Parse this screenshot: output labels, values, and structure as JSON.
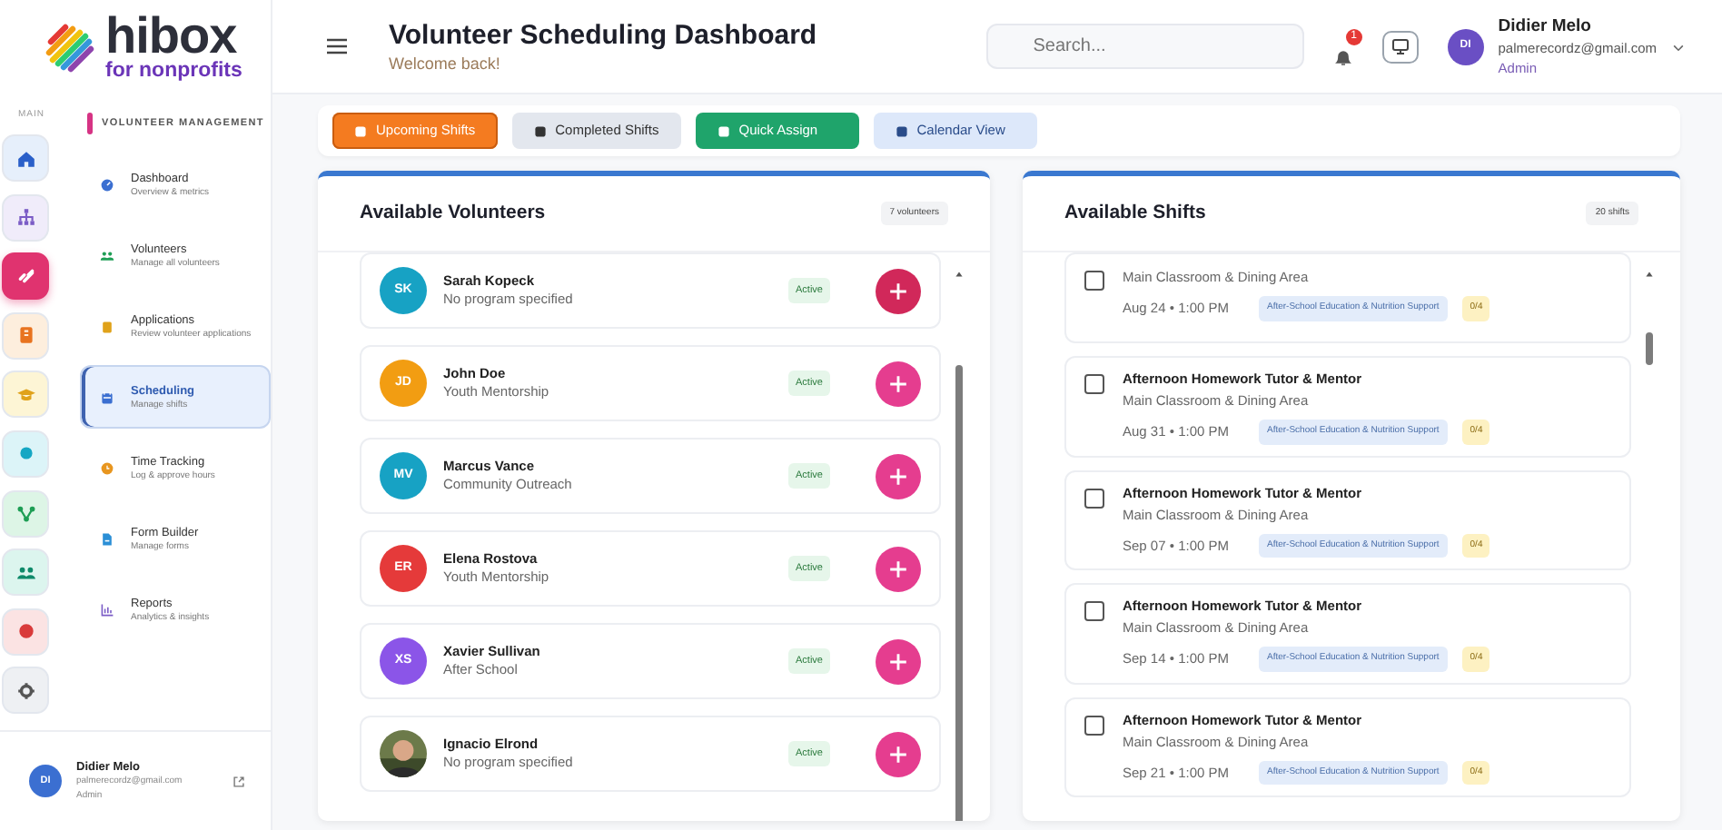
{
  "logo": {
    "name": "hibox",
    "tagline": "for nonprofits"
  },
  "header": {
    "title": "Volunteer Scheduling Dashboard",
    "subtitle": "Welcome back!",
    "search": {
      "placeholder": "Search..."
    },
    "notification_count": "1",
    "user": {
      "initials": "DI",
      "name": "Didier Melo",
      "email": "palmerecordz@gmail.com",
      "role": "Admin"
    }
  },
  "sidebar": {
    "rail_label": "MAIN",
    "rail": [
      {
        "selected": false
      },
      {
        "selected": false
      },
      {
        "selected": true
      },
      {
        "selected": false
      },
      {
        "selected": false
      },
      {
        "selected": false
      },
      {
        "selected": false
      },
      {
        "selected": false
      },
      {
        "selected": false
      },
      {
        "selected": false
      }
    ],
    "section": "VOLUNTEER MANAGEMENT",
    "items": [
      {
        "title": "Dashboard",
        "subtitle": "Overview & metrics",
        "selected": false
      },
      {
        "title": "Volunteers",
        "subtitle": "Manage all volunteers",
        "selected": false
      },
      {
        "title": "Applications",
        "subtitle": "Review volunteer applications",
        "selected": false
      },
      {
        "title": "Scheduling",
        "subtitle": "Manage shifts",
        "selected": true
      },
      {
        "title": "Time Tracking",
        "subtitle": "Log & approve hours",
        "selected": false
      },
      {
        "title": "Form Builder",
        "subtitle": "Manage forms",
        "selected": false
      },
      {
        "title": "Reports",
        "subtitle": "Analytics & insights",
        "selected": false
      }
    ],
    "footer": {
      "initials": "DI",
      "name": "Didier Melo",
      "email": "palmerecordz@gmail.com",
      "role": "Admin"
    }
  },
  "toolbar": [
    {
      "label": "Upcoming Shifts",
      "selected": true
    },
    {
      "label": "Completed Shifts",
      "selected": false
    },
    {
      "label": "Quick Assign",
      "selected": false
    },
    {
      "label": "Calendar View",
      "selected": false
    }
  ],
  "volunteers": {
    "title": "Available Volunteers",
    "count": "7 volunteers",
    "items": [
      {
        "initials": "SK",
        "name": "Sarah Kopeck",
        "program": "No program specified",
        "status": "Active",
        "color": "#17a2c4",
        "hovered": true
      },
      {
        "initials": "JD",
        "name": "John Doe",
        "program": "Youth Mentorship",
        "status": "Active",
        "color": "#f29d12",
        "hovered": false
      },
      {
        "initials": "MV",
        "name": "Marcus Vance",
        "program": "Community Outreach",
        "status": "Active",
        "color": "#17a2c4",
        "hovered": false
      },
      {
        "initials": "ER",
        "name": "Elena Rostova",
        "program": "Youth Mentorship",
        "status": "Active",
        "color": "#e53a3a",
        "hovered": false
      },
      {
        "initials": "XS",
        "name": "Xavier Sullivan",
        "program": "After School",
        "status": "Active",
        "color": "#8b55e8",
        "hovered": false
      },
      {
        "kind": "picture",
        "name": "Ignacio Elrond",
        "program": "No program specified",
        "status": "Active",
        "hovered": false
      }
    ]
  },
  "shifts": {
    "title": "Available Shifts",
    "count": "20 shifts",
    "items": [
      {
        "location": "Main Classroom & Dining Area",
        "date": "Aug 24 • 1:00 PM",
        "program": "After-School Education & Nutrition Support",
        "filled": "0/4",
        "checked": false
      },
      {
        "title": "Afternoon Homework Tutor & Mentor",
        "location": "Main Classroom & Dining Area",
        "date": "Aug 31 • 1:00 PM",
        "program": "After-School Education & Nutrition Support",
        "filled": "0/4",
        "checked": false
      },
      {
        "title": "Afternoon Homework Tutor & Mentor",
        "location": "Main Classroom & Dining Area",
        "date": "Sep 07 • 1:00 PM",
        "program": "After-School Education & Nutrition Support",
        "filled": "0/4",
        "checked": false
      },
      {
        "title": "Afternoon Homework Tutor & Mentor",
        "location": "Main Classroom & Dining Area",
        "date": "Sep 14 • 1:00 PM",
        "program": "After-School Education & Nutrition Support",
        "filled": "0/4",
        "checked": false
      },
      {
        "title": "Afternoon Homework Tutor & Mentor",
        "location": "Main Classroom & Dining Area",
        "date": "Sep 21 • 1:00 PM",
        "program": "After-School Education & Nutrition Support",
        "filled": "0/4",
        "checked": false
      }
    ]
  }
}
